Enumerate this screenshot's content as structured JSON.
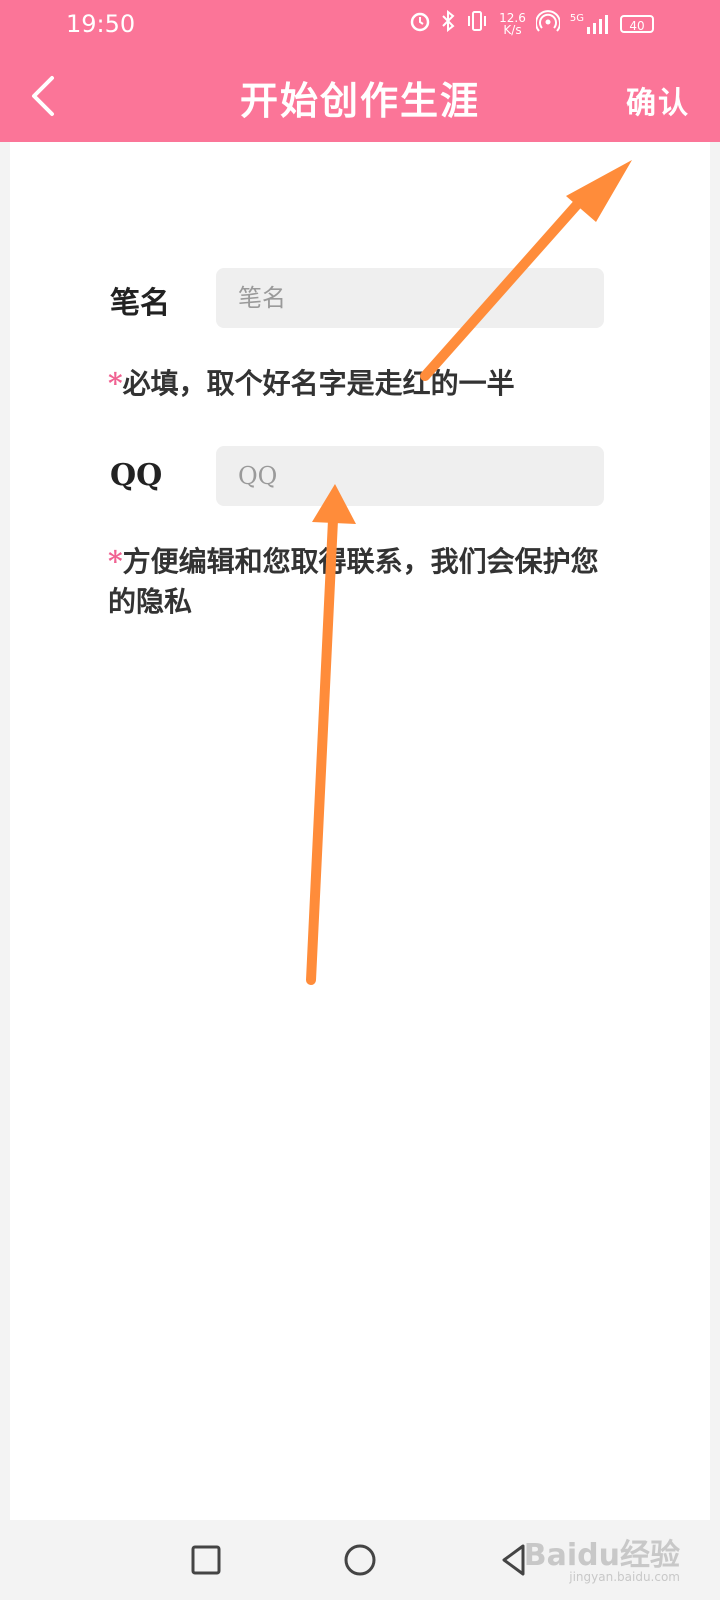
{
  "status_bar": {
    "time": "19:50",
    "network_speed_value": "12.6",
    "network_speed_unit": "K/s",
    "signal_label": "5G",
    "battery": "40",
    "icons": [
      "alarm-icon",
      "bluetooth-icon",
      "vibrate-icon",
      "hotspot-icon",
      "signal-icon",
      "battery-icon"
    ]
  },
  "header": {
    "title": "开始创作生涯",
    "confirm_label": "确认",
    "back_icon": "chevron-left-icon"
  },
  "form": {
    "pen_name": {
      "label": "笔名",
      "placeholder": "笔名",
      "value": "",
      "hint_mark": "*",
      "hint": "必填，取个好名字是走红的一半"
    },
    "qq": {
      "label": "QQ",
      "placeholder": "QQ",
      "value": "",
      "hint_mark": "*",
      "hint": "方便编辑和您取得联系，我们会保护您的隐私"
    }
  },
  "annotations": {
    "arrow_color": "#ff8c3a"
  },
  "nav_bar": {
    "icons": [
      "recent-apps-icon",
      "home-icon",
      "back-triangle-icon"
    ]
  },
  "watermark": {
    "brand": "Baidu经验",
    "url": "jingyan.baidu.com"
  },
  "colors": {
    "primary": "#fb7598",
    "required_mark": "#f06292"
  }
}
